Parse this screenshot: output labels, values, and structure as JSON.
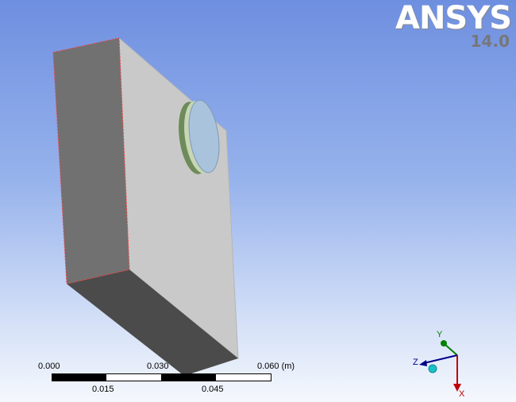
{
  "logo": {
    "text": "ANSYS",
    "version": "14.0"
  },
  "scale_bar": {
    "top_labels": [
      "0.000",
      "0.030",
      "0.060 (m)"
    ],
    "bottom_labels": [
      "0.015",
      "0.045"
    ]
  },
  "triad": {
    "x_label": "X",
    "y_label": "Y",
    "z_label": "Z"
  },
  "colors": {
    "block_front": "#6f6f6f",
    "block_side": "#c8c8c8",
    "block_bottom": "#4a4a4a",
    "edge_highlight": "#ff3b3b",
    "disk_face": "#a9c3dd",
    "disk_rim": "#6e8b5a",
    "axis_x": "#c00000",
    "axis_y": "#008000",
    "axis_z": "#00008b"
  }
}
